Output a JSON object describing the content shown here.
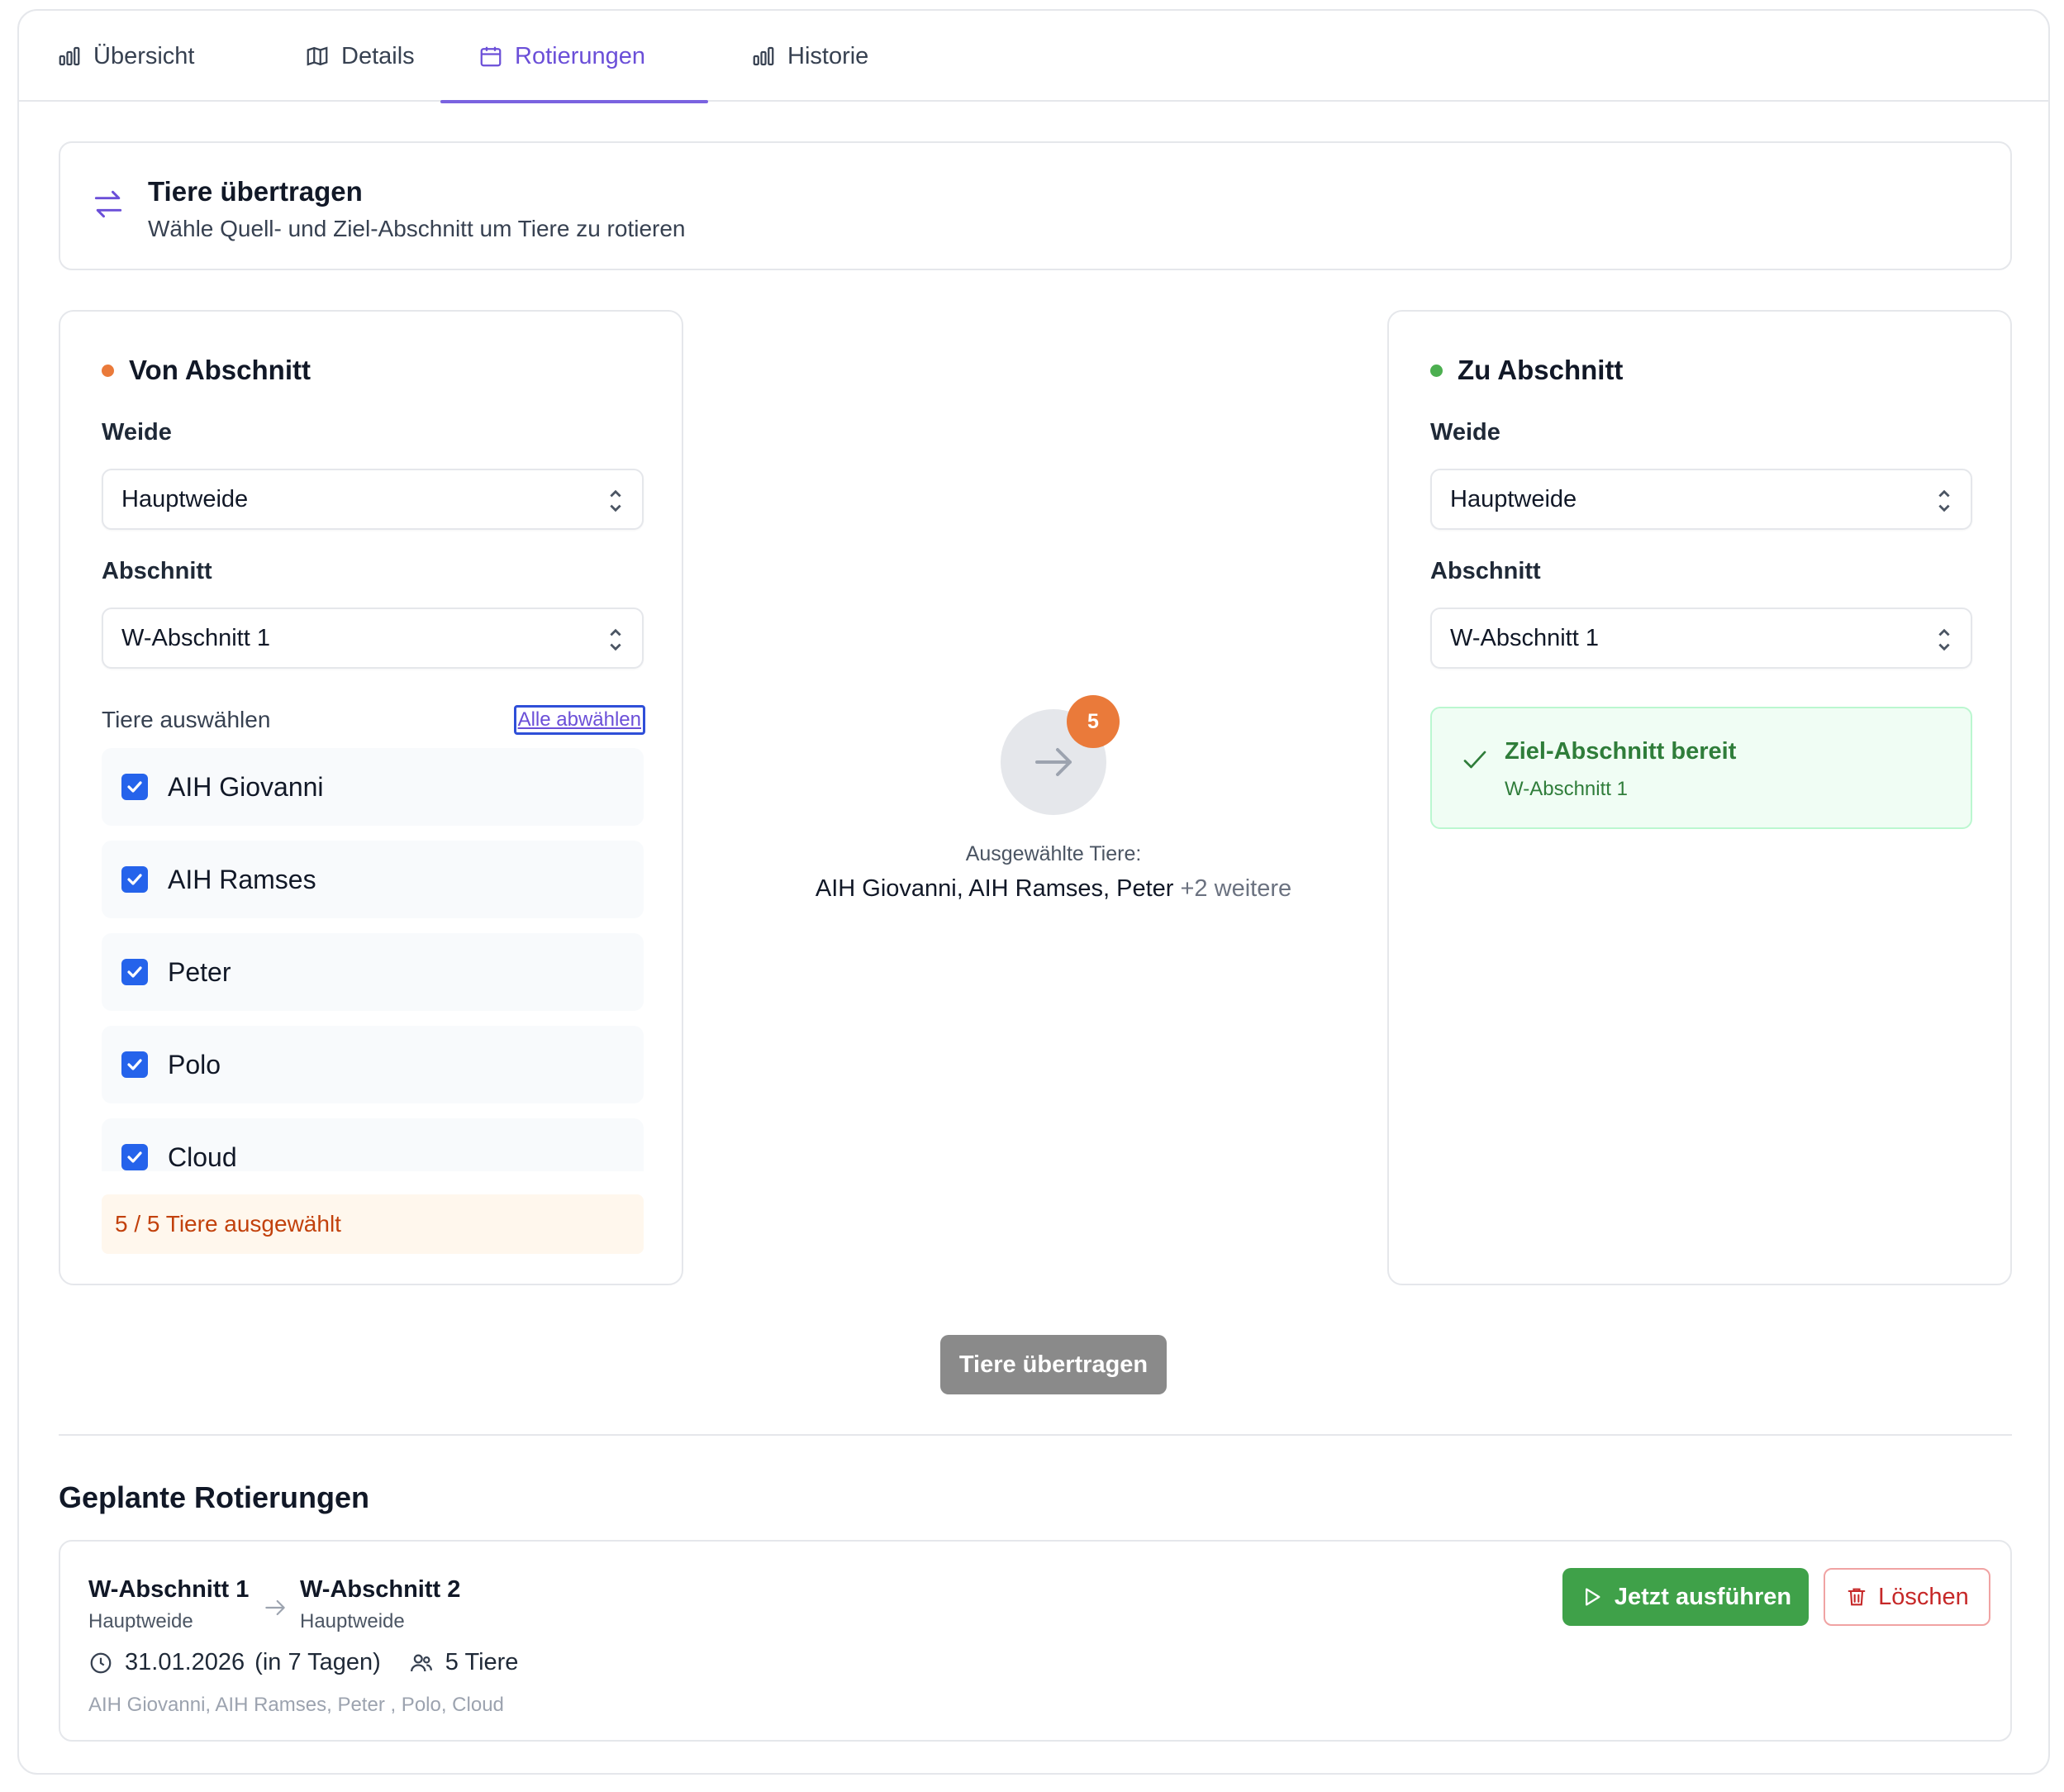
{
  "tabs": [
    {
      "label": "Übersicht",
      "icon": "bar-chart-icon"
    },
    {
      "label": "Details",
      "icon": "map-icon"
    },
    {
      "label": "Rotierungen",
      "icon": "calendar-icon",
      "active": true
    },
    {
      "label": "Historie",
      "icon": "bar-chart-icon"
    }
  ],
  "header": {
    "title": "Tiere übertragen",
    "subtitle": "Wähle Quell- und Ziel-Abschnitt um Tiere zu rotieren",
    "icon": "swap-arrows-icon"
  },
  "from": {
    "title": "Von Abschnitt",
    "dot_color": "#ea7a3a",
    "weide_label": "Weide",
    "weide_value": "Hauptweide",
    "abschnitt_label": "Abschnitt",
    "abschnitt_value": "W-Abschnitt 1",
    "select_label": "Tiere auswählen",
    "deselect_all": "Alle abwählen",
    "animals": [
      "AIH Giovanni",
      "AIH Ramses",
      "Peter",
      "Polo",
      "Cloud"
    ],
    "count_text": "5 / 5 Tiere ausgewählt"
  },
  "to": {
    "title": "Zu Abschnitt",
    "dot_color": "#4caf50",
    "weide_label": "Weide",
    "weide_value": "Hauptweide",
    "abschnitt_label": "Abschnitt",
    "abschnitt_value": "W-Abschnitt 1",
    "ready_title": "Ziel-Abschnitt bereit",
    "ready_sub": "W-Abschnitt 1"
  },
  "middle": {
    "badge": "5",
    "label": "Ausgewählte Tiere:",
    "names": "AIH Giovanni, AIH Ramses, Peter",
    "more": "+2 weitere"
  },
  "transfer_button": "Tiere übertragen",
  "scheduled": {
    "title": "Geplante Rotierungen",
    "items": [
      {
        "from_name": "W-Abschnitt 1",
        "from_sub": "Hauptweide",
        "to_name": "W-Abschnitt 2",
        "to_sub": "Hauptweide",
        "date": "31.01.2026",
        "relative": "(in 7 Tagen)",
        "animal_count": "5 Tiere",
        "animals": "AIH Giovanni, AIH Ramses, Peter , Polo, Cloud",
        "run_label": "Jetzt ausführen",
        "delete_label": "Löschen"
      }
    ]
  },
  "colors": {
    "accent": "#6b4fd8",
    "run_green": "#3fa149",
    "delete_red": "#c62828",
    "checkbox_blue": "#2563eb"
  }
}
